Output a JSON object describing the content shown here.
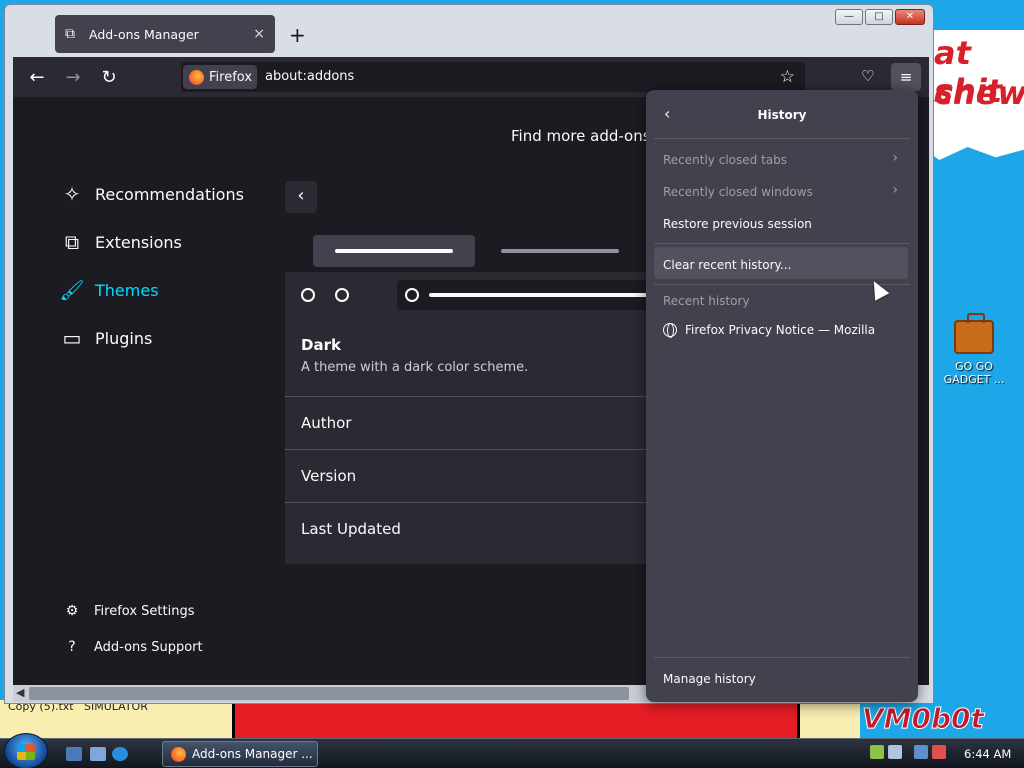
{
  "desktop": {
    "bg_text_line1": "at shit",
    "bg_text_line2": "chew",
    "copy_label": "Copy (5).txt",
    "sim_label": "SIMULATOR",
    "signature": "VM0b0t",
    "icon_label": "GO GO GADGET ..."
  },
  "window": {
    "controls": {
      "minimize": "—",
      "maximize": "□",
      "close": "✕"
    }
  },
  "tab": {
    "title": "Add-ons Manager",
    "close": "×",
    "new_tab": "+"
  },
  "toolbar": {
    "back": "←",
    "forward": "→",
    "reload": "↻",
    "identity_label": "Firefox",
    "url": "about:addons",
    "star": "☆",
    "pocket": "♡",
    "menu": "≡"
  },
  "addons": {
    "find_more": "Find more add-ons",
    "categories": [
      {
        "label": "Recommendations",
        "icon": "✧"
      },
      {
        "label": "Extensions",
        "icon": "⧉"
      },
      {
        "label": "Themes",
        "icon": "🖌"
      },
      {
        "label": "Plugins",
        "icon": "▭"
      }
    ],
    "footer": [
      {
        "label": "Firefox Settings",
        "icon": "⚙"
      },
      {
        "label": "Add-ons Support",
        "icon": "?"
      }
    ],
    "back": "‹",
    "theme": {
      "name": "Dark",
      "description": "A theme with a dark color scheme.",
      "rows": [
        "Author",
        "Version",
        "Last Updated"
      ]
    }
  },
  "history_panel": {
    "back": "‹",
    "title": "History",
    "recently_closed_tabs": "Recently closed tabs",
    "recently_closed_windows": "Recently closed windows",
    "restore_session": "Restore previous session",
    "clear_recent": "Clear recent history...",
    "recent_history_heading": "Recent history",
    "recent_items": [
      "Firefox Privacy Notice — Mozilla"
    ],
    "manage_history": "Manage history",
    "arrow": "›"
  },
  "taskbar": {
    "active_task": "Add-ons Manager ...",
    "clock": "6:44 AM"
  },
  "colors": {
    "accent": "#00ddff",
    "panel_bg": "#42414d",
    "content_bg": "#1c1b22"
  }
}
